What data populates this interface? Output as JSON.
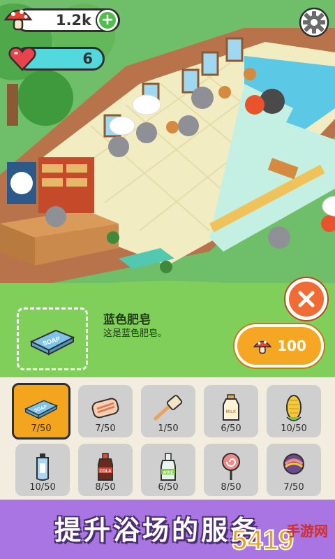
{
  "hud": {
    "coins": "1.2k",
    "add_symbol": "+",
    "hearts": "6"
  },
  "detail": {
    "item_name": "蓝色肥皂",
    "item_description": "这是蓝色肥皂。",
    "price": "100",
    "preview_label": "SOAP"
  },
  "inventory": [
    {
      "icon": "soap-icon",
      "label": "SOAP",
      "count": "7/50",
      "selected": true
    },
    {
      "icon": "towel-icon",
      "count": "7/50"
    },
    {
      "icon": "brush-icon",
      "count": "1/50"
    },
    {
      "icon": "milk-icon",
      "label": "MILK",
      "count": "6/50"
    },
    {
      "icon": "corn-icon",
      "count": "10/50"
    },
    {
      "icon": "lotion-icon",
      "count": "10/50"
    },
    {
      "icon": "cola-icon",
      "label": "COLA",
      "count": "8/50"
    },
    {
      "icon": "wine-icon",
      "label": "WINE",
      "count": "6/50"
    },
    {
      "icon": "lollipop-icon",
      "count": "8/50"
    },
    {
      "icon": "candy-icon",
      "count": "7/50"
    }
  ],
  "banner": {
    "title": "提升浴场的服务"
  },
  "watermark": {
    "number": "5419",
    "site": "手游网",
    "tagline": "手游网"
  },
  "colors": {
    "panel_green": "#7fcf5a",
    "selected_orange": "#f4a51e",
    "close_orange": "#f16b35",
    "banner_purple": "#a875e3",
    "water_teal": "#52d9de"
  }
}
